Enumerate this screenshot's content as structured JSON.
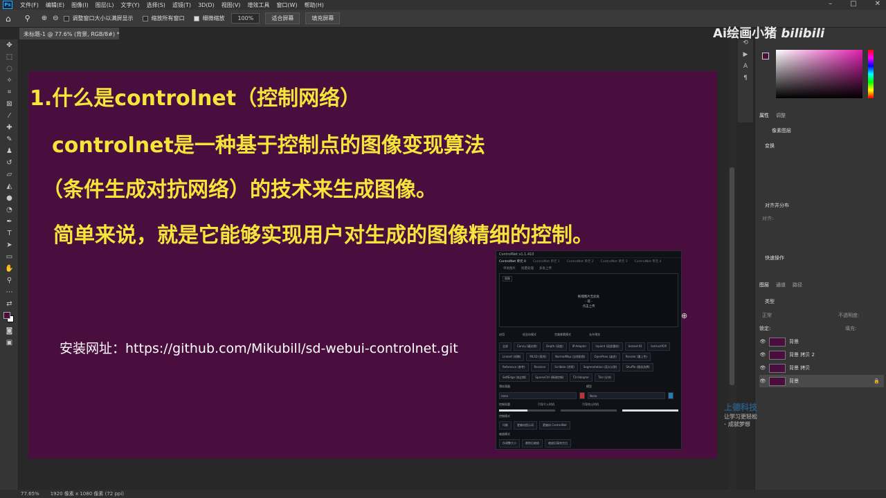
{
  "menubar": {
    "logo": "Ps",
    "items": [
      "文件(F)",
      "编辑(E)",
      "图像(I)",
      "图层(L)",
      "文字(Y)",
      "选择(S)",
      "滤镜(T)",
      "3D(D)",
      "视图(V)",
      "增效工具",
      "窗口(W)",
      "帮助(H)"
    ]
  },
  "options": {
    "resize_windows": "调整窗口大小以满屏显示",
    "zoom_all": "缩放所有窗口",
    "scrubby_zoom": "细微缩放",
    "zoom_value": "100%",
    "fit_screen": "适合屏幕",
    "fill_screen": "填充屏幕"
  },
  "doc_tab": "未标题-1 @ 77.6% (背景, RGB/8#) *",
  "slide": {
    "title": "1.什么是controlnet（控制网络）",
    "line1": "controlnet是一种基于控制点的图像变现算法",
    "line2": "（条件生成对抗网络）的技术来生成图像。",
    "line3": "简单来说，就是它能够实现用户对生成的图像精细的控制。",
    "install_url": "安装网址：https://github.com/Mikubill/sd-webui-controlnet.git"
  },
  "controlnet": {
    "header": "ControlNet v1.1.410",
    "units": [
      "ControlNet 单元 0",
      "ControlNet 单元 1",
      "ControlNet 单元 2",
      "ControlNet 单元 3",
      "ControlNet 单元 4"
    ],
    "subtabs": [
      "单张图片",
      "批量处理",
      "多张上传"
    ],
    "image_tag": "图像",
    "drop_text_1": "拖拽图片至此处",
    "drop_text_2": "- 或 -",
    "drop_text_3": "点击上传",
    "options": [
      "启用",
      "低显存模式",
      "完美像素模式",
      "允许预览"
    ],
    "control_types": [
      "全部",
      "Canny (硬边缘)",
      "Depth (深度)",
      "IP-Adapter",
      "Inpaint (局部重绘)",
      "Instant-ID",
      "InstructP2P",
      "Lineart (线稿)",
      "MLSD (直线)",
      "NormalMap (法线贴图)",
      "OpenPose (姿态)",
      "Recolor (重上色)",
      "Reference (参考)",
      "Revision",
      "Scribble (涂鸦)",
      "Segmentation (语义分割)",
      "Shuffle (随机洗牌)",
      "SoftEdge (软边缘)",
      "SparseCtrl (稀疏控制)",
      "T2I-Adapter",
      "Tile (分块)"
    ],
    "preprocessor_label": "预处理器",
    "preprocessor": "none",
    "model_label": "模型",
    "model": "None",
    "weight_label": "控制权重",
    "start_label": "引导介入时机",
    "end_label": "引导终止时机",
    "weight": 1,
    "start": 0,
    "end": 1,
    "mode_label": "控制模式",
    "modes": [
      "均衡",
      "更偏向提示词",
      "更偏向 ControlNet"
    ],
    "resize_label": "缩放模式",
    "resize": [
      "仅调整大小",
      "裁剪后缩放",
      "缩放后填充空白"
    ]
  },
  "status": {
    "zoom": "77.65%",
    "size": "1920 像素 x 1080 像素 (72 ppi)"
  },
  "panels": {
    "prop_tabs": [
      "属性",
      "调整"
    ],
    "pixel_layer": "像素图层",
    "transform": "变换",
    "align": "对齐并分布",
    "align_label": "对齐:",
    "quick_actions": "快速操作",
    "layer_tabs": [
      "图层",
      "通道",
      "路径"
    ],
    "kind": "类型",
    "normal": "正常",
    "opacity": "不透明度:",
    "lock": "锁定:",
    "fill": "填充:",
    "layers": [
      "背景",
      "背景 拷贝 2",
      "背景 拷贝",
      "背景"
    ]
  },
  "watermark": {
    "text": "Ai绘画小猪",
    "brand": "bilibili",
    "corner_text": "上德科技",
    "corner_sub": "让学习更轻松 · 成就梦想"
  }
}
